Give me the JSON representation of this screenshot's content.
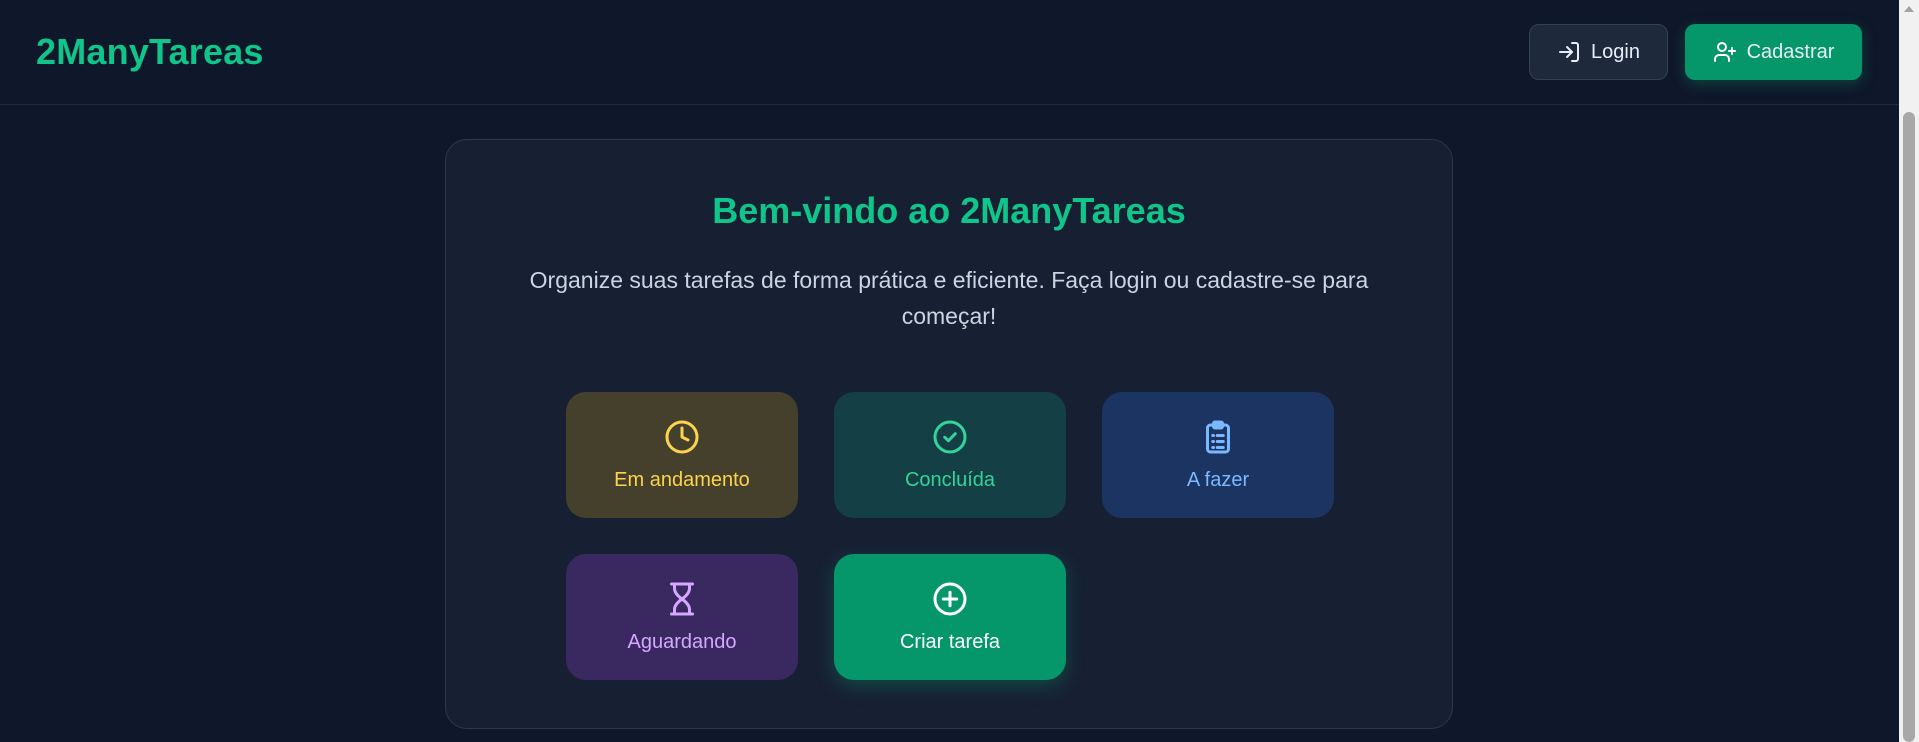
{
  "header": {
    "brand": "2ManyTareas",
    "login_label": "Login",
    "register_label": "Cadastrar"
  },
  "welcome": {
    "title": "Bem-vindo ao 2ManyTareas",
    "subtitle": "Organize suas tarefas de forma prática e eficiente. Faça login ou cadastre-se para começar!"
  },
  "tiles": [
    {
      "label": "Em andamento",
      "icon": "clock-icon"
    },
    {
      "label": "Concluída",
      "icon": "check-circle-icon"
    },
    {
      "label": "A fazer",
      "icon": "clipboard-list-icon"
    },
    {
      "label": "Aguardando",
      "icon": "hourglass-icon"
    },
    {
      "label": "Criar tarefa",
      "icon": "plus-circle-icon"
    }
  ],
  "colors": {
    "brand": "#10c589",
    "background": "#0f172a",
    "card": "#172033",
    "primary_button": "#059669"
  }
}
